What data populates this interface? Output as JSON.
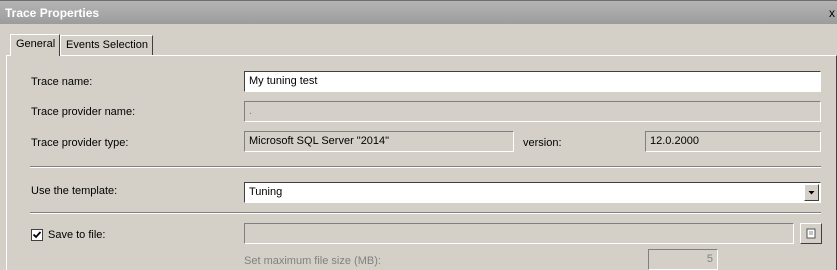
{
  "window": {
    "title": "Trace Properties",
    "close_glyph": "x"
  },
  "tabs": [
    {
      "label": "General"
    },
    {
      "label": "Events Selection"
    }
  ],
  "general": {
    "trace_name_label": "Trace name:",
    "trace_name_value": "My tuning test",
    "provider_name_label": "Trace provider name:",
    "provider_name_value": ".",
    "provider_type_label": "Trace provider type:",
    "provider_type_value": "Microsoft SQL Server \"2014\"",
    "version_label": "version:",
    "version_value": "12.0.2000",
    "template_label": "Use the template:",
    "template_value": "Tuning",
    "save_to_file_label": "Save to file:",
    "save_to_file_checked": true,
    "save_to_file_path": "",
    "max_size_label": "Set maximum file size (MB):",
    "max_size_value": "5"
  },
  "icons": {
    "dropdown": "triangle-down-icon",
    "browse": "folder-browse-icon",
    "check": "checkmark-icon"
  }
}
